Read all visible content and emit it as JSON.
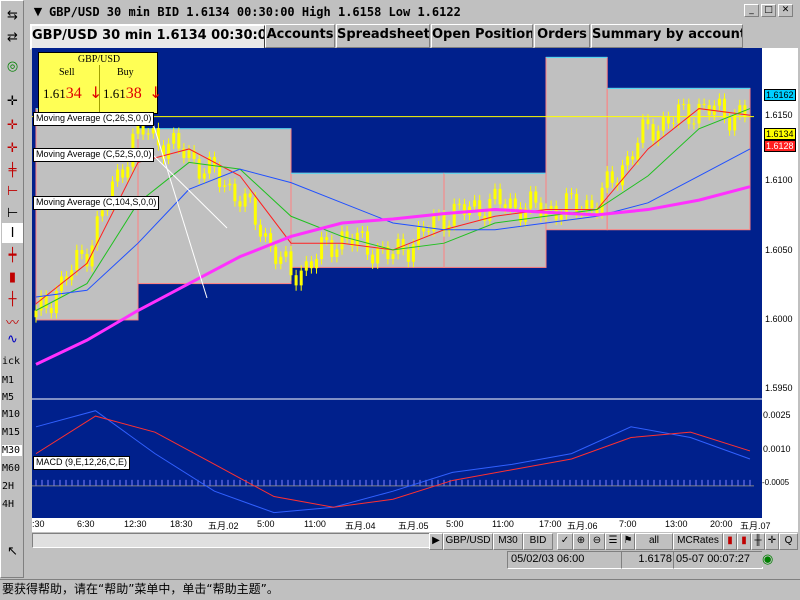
{
  "window": {
    "title": "GBP/USD 30 min BID 1.6134 00:30:00 High 1.6158 Low 1.6122"
  },
  "tabs": [
    {
      "label": "GBP/USD 30 min 1.6134 00:30:00",
      "active": true
    },
    {
      "label": "Accounts",
      "active": false
    },
    {
      "label": "Spreadsheet",
      "active": false
    },
    {
      "label": "Open Position",
      "active": false
    },
    {
      "label": "Orders",
      "active": false
    },
    {
      "label": "Summary by accounts",
      "active": false
    }
  ],
  "quote": {
    "symbol": "GBP/USD",
    "sell_label": "Sell",
    "buy_label": "Buy",
    "sell_prefix": "1.61",
    "sell_big": "34",
    "buy_prefix": "1.61",
    "buy_big": "38",
    "arrow": "↓"
  },
  "indicators": {
    "ma1": "Moving Average (C,26,S,0,0)",
    "ma2": "Moving Average (C,52,S,0,0)",
    "ma3": "Moving Average (C,104,S,0,0)",
    "macd": "MACD (9,E,12,26,C,E)"
  },
  "price_axis": {
    "labels": [
      "1.6150",
      "1.6100",
      "1.6050",
      "1.6000",
      "1.5950"
    ],
    "current_box": "1.6162",
    "bid_box": "1.6134",
    "ask_box": "1.6128",
    "macd_labels": [
      "0.0025",
      "0.0010",
      "-0.0005"
    ]
  },
  "time_axis": [
    "6:30",
    "12:30",
    "18:30",
    "五月.02",
    "5:00",
    "11:00",
    "五月.04",
    "五月.05",
    "5:00",
    "11:00",
    "17:00",
    "五月.06",
    "7:00",
    "13:00",
    "20:00",
    "五月.07"
  ],
  "time_axis_partial": ":30",
  "bottom": {
    "symbol_button": "GBP/USD",
    "period_button": "M30",
    "side_button": "BID",
    "all_button": "all",
    "rates_button": "MCRates",
    "q_button": "Q"
  },
  "status": {
    "cursor_time": "05/02/03 06:00",
    "cursor_price": "1.6178",
    "clock": "05-07 00:07:27"
  },
  "left_toolbar": {
    "tick_label": "ick",
    "periods": [
      "M1",
      "M5",
      "M10",
      "M15",
      "M30",
      "M60",
      "2H",
      "4H"
    ],
    "selected_period": "M30"
  },
  "help_text": "要获得帮助，请在“帮助”菜单中，单击“帮助主题”。",
  "colors": {
    "chart_bg": "#00208c",
    "box_fill": "#c0c0c0",
    "candle": "#ffff00",
    "ma26": "#ff2020",
    "ma52": "#20c020",
    "ma104": "#2050ff",
    "long_ma": "#ff30ff",
    "quote_bg": "#ffff55"
  },
  "chart_data": {
    "type": "line",
    "title": "GBP/USD 30 min BID",
    "ylim": [
      1.5925,
      1.6185
    ],
    "series": [
      {
        "name": "price (approx. close)",
        "values": [
          1.5985,
          1.6035,
          1.6125,
          1.6105,
          1.6075,
          1.6015,
          1.6045,
          1.603,
          1.606,
          1.607,
          1.6065,
          1.607,
          1.6125,
          1.614,
          1.6134
        ]
      },
      {
        "name": "Moving Average (C,26,S,0,0)",
        "values": [
          1.5995,
          1.6025,
          1.61,
          1.611,
          1.609,
          1.604,
          1.604,
          1.6035,
          1.605,
          1.606,
          1.6065,
          1.6065,
          1.611,
          1.614,
          1.6135
        ]
      },
      {
        "name": "Moving Average (C,52,S,0,0)",
        "values": [
          1.599,
          1.601,
          1.607,
          1.61,
          1.6095,
          1.606,
          1.6045,
          1.6035,
          1.604,
          1.6055,
          1.606,
          1.6065,
          1.609,
          1.6125,
          1.614
        ]
      },
      {
        "name": "Moving Average (C,104,S,0,0)",
        "values": [
          1.6,
          1.6005,
          1.604,
          1.608,
          1.6095,
          1.6085,
          1.607,
          1.6055,
          1.605,
          1.605,
          1.6055,
          1.606,
          1.607,
          1.609,
          1.611
        ]
      },
      {
        "name": "long MA",
        "values": [
          1.595,
          1.5968,
          1.599,
          1.601,
          1.603,
          1.6045,
          1.6055,
          1.6058,
          1.6062,
          1.6065,
          1.6063,
          1.6061,
          1.6065,
          1.6072,
          1.6082
        ]
      }
    ],
    "boxes_high_low": [
      {
        "from": 0,
        "to": 2,
        "high": 1.614,
        "low": 1.5983
      },
      {
        "from": 2,
        "to": 5,
        "high": 1.6125,
        "low": 1.601
      },
      {
        "from": 5,
        "to": 8,
        "high": 1.6092,
        "low": 1.6022
      },
      {
        "from": 8,
        "to": 10,
        "high": 1.6092,
        "low": 1.6022
      },
      {
        "from": 10,
        "to": 11.2,
        "high": 1.6178,
        "low": 1.605
      },
      {
        "from": 11.2,
        "to": 14,
        "high": 1.6155,
        "low": 1.605
      }
    ],
    "macd_series": {
      "name": "MACD (9,E,12,26,C,E)",
      "ylim": [
        -0.0012,
        0.0032
      ],
      "macd": [
        0.0022,
        0.0028,
        0.0012,
        -0.0002,
        -0.001,
        -0.0008,
        -0.0002,
        0.0005,
        0.0008,
        0.0012,
        0.0022,
        0.0018,
        0.001
      ],
      "signal": [
        0.0012,
        0.0026,
        0.002,
        0.0008,
        -0.0004,
        -0.0008,
        -0.0005,
        0.0002,
        0.0006,
        0.001,
        0.0018,
        0.002,
        0.0013
      ]
    }
  }
}
